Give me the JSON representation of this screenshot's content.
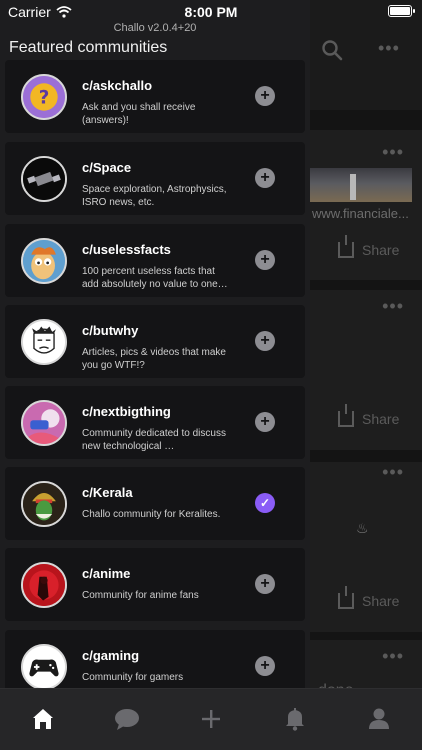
{
  "status_bar": {
    "carrier": "Carrier",
    "time": "8:00 PM"
  },
  "drawer": {
    "version": "Challo v2.0.4+20",
    "title": "Featured communities",
    "communities": [
      {
        "name": "c/askchallo",
        "description": "Ask and you shall receive (answers)!",
        "joined": false,
        "icon": "question-mark-icon",
        "action": "+"
      },
      {
        "name": "c/Space",
        "description": "Space exploration, Astrophysics, ISRO news, etc.",
        "joined": false,
        "icon": "satellite-icon",
        "action": "+"
      },
      {
        "name": "c/uselessfacts",
        "description": "100 percent useless facts that add absolutely no value to one…",
        "joined": false,
        "icon": "cartoon-face-icon",
        "action": "+"
      },
      {
        "name": "c/butwhy",
        "description": "Articles, pics & videos that make you go WTF!?",
        "joined": false,
        "icon": "meme-face-icon",
        "action": "+"
      },
      {
        "name": "c/nextbigthing",
        "description": "Community dedicated to discuss new technological …",
        "joined": false,
        "icon": "vr-headset-icon",
        "action": "+"
      },
      {
        "name": "c/Kerala",
        "description": "Challo community for Keralites.",
        "joined": true,
        "icon": "kathakali-icon",
        "action": "✓"
      },
      {
        "name": "c/anime",
        "description": "Community for anime fans",
        "joined": false,
        "icon": "anime-character-icon",
        "action": "+"
      },
      {
        "name": "c/gaming",
        "description": "Community for gamers",
        "joined": false,
        "icon": "gamepad-icon",
        "action": "+"
      }
    ]
  },
  "background": {
    "url_snippet": "www.financiale...",
    "share_label": "Share",
    "partial_text": "done"
  },
  "tabbar": {
    "tabs": [
      {
        "name": "home",
        "icon": "home-icon",
        "active": true
      },
      {
        "name": "chat",
        "icon": "chat-bubble-icon",
        "active": false
      },
      {
        "name": "create",
        "icon": "plus-icon",
        "active": false
      },
      {
        "name": "notifications",
        "icon": "bell-icon",
        "active": false
      },
      {
        "name": "profile",
        "icon": "person-icon",
        "active": false
      }
    ]
  },
  "colors": {
    "accent": "#8a5cf6",
    "drawer_bg": "#1d1d1f",
    "card_bg": "#141416",
    "tabbar_bg": "#262628"
  }
}
